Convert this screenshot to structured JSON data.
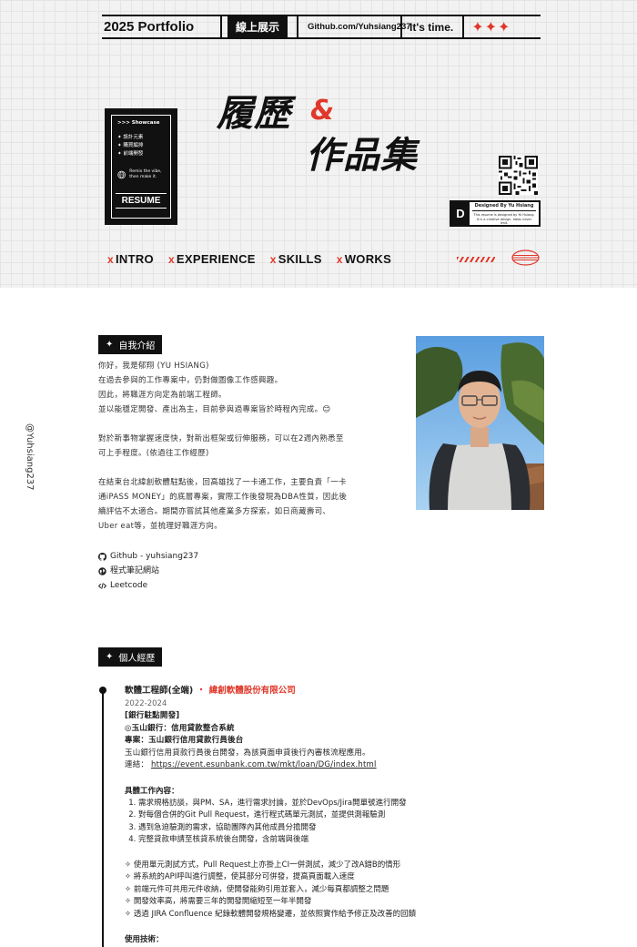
{
  "topbar": {
    "brand": "2025 Portfolio",
    "badge": "線上展示",
    "github": "Github.com/Yuhsiang237",
    "tagline": "It's time.",
    "stars": "✦✦✦"
  },
  "hero": {
    "title_1": "履歷",
    "ampersand": "&",
    "title_2": "作品集"
  },
  "card": {
    "header": ">>> Showcase",
    "items": [
      "設計元素",
      "購買編排",
      "前端開發"
    ],
    "motto": "Remix the vibe, then make it.",
    "resume": "RESUME"
  },
  "designed": {
    "mark": "D",
    "title": "Designed By Yu Hsiang",
    "small": "This resume is designed by Yu Hsiang. It is a creative design. Ideas never limit."
  },
  "nav": [
    {
      "x": "x",
      "label": "INTRO"
    },
    {
      "x": "x",
      "label": "EXPERIENCE"
    },
    {
      "x": "x",
      "label": "SKILLS"
    },
    {
      "x": "x",
      "label": "WORKS"
    }
  ],
  "side_handle": "@Yuhsiang237",
  "about": {
    "tag": "自我介紹",
    "p1": [
      "你好，我是郁翔 (YU HSIANG)",
      "在過去參與的工作專案中，仍對做圖像工作感興趣。",
      "因此，將職涯方向定為前端工程師。",
      "並以能穩定開發、產出為主，目前參與過專案皆於時程內完成。😊"
    ],
    "p2": [
      "對於新事物掌握速度快，對新出框架或衍伸服務，可以在2週內熟悉至",
      "可上手程度。(依過往工作經歷)"
    ],
    "p3": [
      "在結束台北緯創軟體駐點後，回高雄找了一卡通工作，主要負責「一卡",
      "通iPASS MONEY」的底層專案，實際工作後發現為DBA性質，因此後",
      "續評估不太適合。期間亦嘗試其他產業多方探索，如日商藏壽司、",
      "Uber eat等，並梳理好職涯方向。"
    ],
    "links": [
      "Github - yuhsiang237",
      "程式筆記網站",
      "Leetcode"
    ]
  },
  "experience": {
    "tag": "個人經歷",
    "title": "軟體工程師(全端)",
    "dot": "・",
    "company": "緯創軟體股份有限公司",
    "years": "2022-2024",
    "l1": "[銀行駐點開發]",
    "l2": "◎玉山銀行：信用貸款整合系統",
    "l3": "專案：玉山銀行信用貸款行員後台",
    "l4": "玉山銀行信用貸款行員後台開發，為該頁面申貸後行內審核流程應用。",
    "l5_label": "連結：",
    "l5_link": "https://event.esunbank.com.tw/mkt/loan/DG/index.html",
    "sub": "具體工作內容：",
    "ol": [
      "需求規格訪談，與PM、SA，進行需求討論，並於DevOps/Jira開單號進行開發",
      "對每個合併的Git Pull Request，進行程式碼單元測試，並提供測報驗測",
      "遇到急迫驗測的需求，協助團隊內其他成員分擔開發",
      "完整貸款申請至核貸系統後台開發，含前端與後端"
    ],
    "ul": [
      "使用單元測試方式，Pull Request上亦掛上CI一併測試，減少了改A錯B的情形",
      "將系統的API呼叫進行調整，使其部分可併發，提高頁面載入速度",
      "前端元件可共用元件收納，使開發能夠引用並套入，減少每頁都調整之問題",
      "開發效率高，將需要三年的開發開縮短至一年半開發",
      "透過 JIRA Confluence 紀錄軟體開發規格變遷，並依照實作給予修正及改善的回饋"
    ],
    "tech": "使用技術："
  }
}
